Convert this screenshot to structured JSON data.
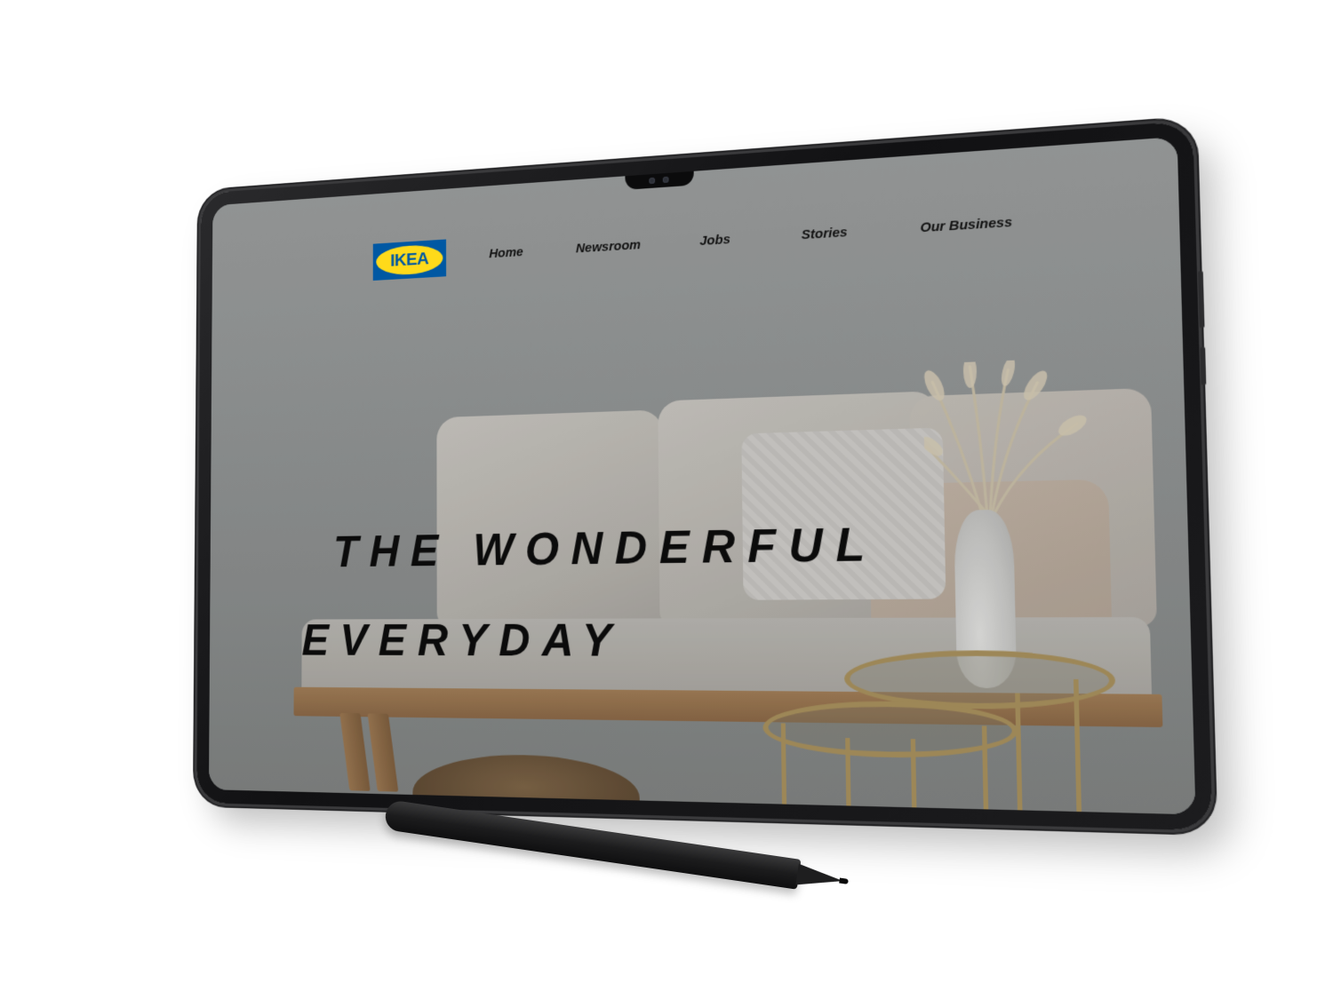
{
  "nav": {
    "logo_text": "IKEA",
    "items": [
      {
        "label": "Home"
      },
      {
        "label": "Newsroom"
      },
      {
        "label": "Jobs"
      },
      {
        "label": "Stories"
      },
      {
        "label": "Our Business"
      }
    ]
  },
  "hero": {
    "line1": "THE WONDERFUL",
    "line2": "EVERYDAY"
  },
  "colors": {
    "brand_blue": "#0058a3",
    "brand_yellow": "#ffda1a",
    "device_body": "#1c1c1e",
    "hero_text": "#0b0b0b"
  },
  "icons": [
    "ikea-logo-icon",
    "camera-icon"
  ]
}
